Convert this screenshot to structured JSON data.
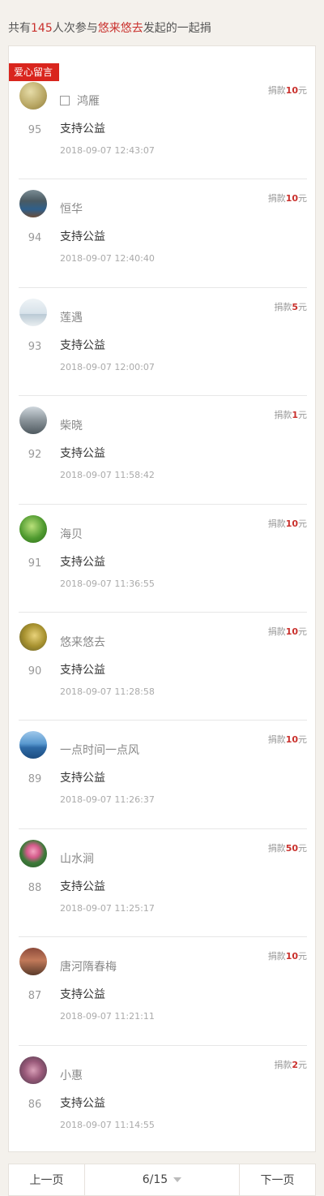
{
  "summary": {
    "prefix": "共有",
    "count": "145",
    "middle": "人次参与",
    "initiator": "悠来悠去",
    "suffix": "发起的一起捐"
  },
  "badge": "爱心留言",
  "amount_prefix": "捐款",
  "amount_suffix": "元",
  "donations": [
    {
      "name": "鸿雁",
      "rank": "95",
      "message": "支持公益",
      "time": "2018-09-07 12:43:07",
      "amount": "10",
      "avatar": "photo",
      "has_checkbox": true
    },
    {
      "name": "恒华",
      "rank": "94",
      "message": "支持公益",
      "time": "2018-09-07 12:40:40",
      "amount": "10",
      "avatar": "photo"
    },
    {
      "name": "莲遇",
      "rank": "93",
      "message": "支持公益",
      "time": "2018-09-07 12:00:07",
      "amount": "5",
      "avatar": "photo"
    },
    {
      "name": "柴晓",
      "rank": "92",
      "message": "支持公益",
      "time": "2018-09-07 11:58:42",
      "amount": "1",
      "avatar": "photo"
    },
    {
      "name": "海贝",
      "rank": "91",
      "message": "支持公益",
      "time": "2018-09-07 11:36:55",
      "amount": "10",
      "avatar": "photo"
    },
    {
      "name": "悠来悠去",
      "rank": "90",
      "message": "支持公益",
      "time": "2018-09-07 11:28:58",
      "amount": "10",
      "avatar": "photo"
    },
    {
      "name": "一点时间一点风",
      "rank": "89",
      "message": "支持公益",
      "time": "2018-09-07 11:26:37",
      "amount": "10",
      "avatar": "photo"
    },
    {
      "name": "山水涧",
      "rank": "88",
      "message": "支持公益",
      "time": "2018-09-07 11:25:17",
      "amount": "50",
      "avatar": "photo"
    },
    {
      "name": "唐河隋春梅",
      "rank": "87",
      "message": "支持公益",
      "time": "2018-09-07 11:21:11",
      "amount": "10",
      "avatar": "photo"
    },
    {
      "name": "小惠",
      "rank": "86",
      "message": "支持公益",
      "time": "2018-09-07 11:14:55",
      "amount": "2",
      "avatar": "photo"
    }
  ],
  "pager": {
    "prev": "上一页",
    "current": "6/15",
    "next": "下一页",
    "dropdown_icon": "caret-down-icon"
  },
  "colors": {
    "accent": "#c9302c",
    "badge": "#d9251d",
    "background": "#f4f1ec"
  }
}
